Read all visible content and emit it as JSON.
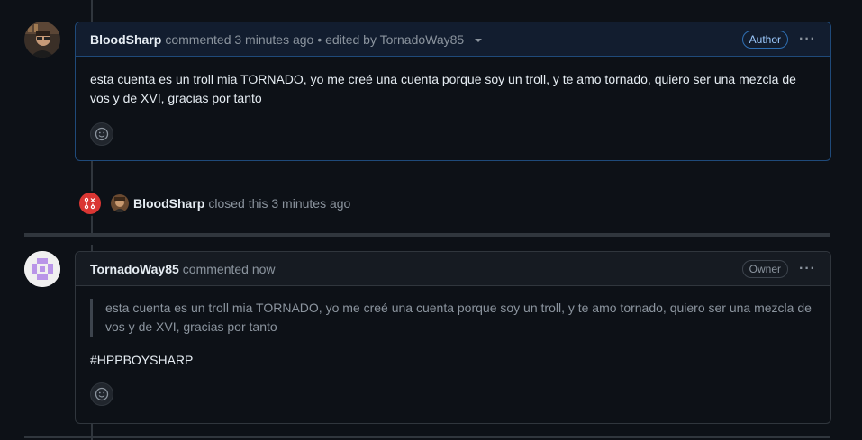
{
  "comment1": {
    "author": "BloodSharp",
    "action": "commented 3 minutes ago",
    "edited": "• edited by TornadoWay85",
    "badge": "Author",
    "body": "esta cuenta es un troll mia TORNADO, yo me creé una cuenta porque soy un troll, y te amo tornado, quiero ser una mezcla de vos y de XVI, gracias por tanto",
    "more_icon": "kebab-horizontal-icon",
    "reaction_icon": "smiley-icon"
  },
  "event": {
    "icon": "issue-closed-icon",
    "user": "BloodSharp",
    "text": "closed this 3 minutes ago",
    "color": "#da3633"
  },
  "comment2": {
    "author": "TornadoWay85",
    "action": "commented now",
    "badge": "Owner",
    "quote": "esta cuenta es un troll mia TORNADO, yo me creé una cuenta porque soy un troll, y te amo tornado, quiero ser una mezcla de vos y de XVI, gracias por tanto",
    "body": "#HPPBOYSHARP",
    "more_icon": "kebab-horizontal-icon",
    "reaction_icon": "smiley-icon"
  },
  "colors": {
    "background": "#0d1117",
    "border": "#30363d",
    "author_border": "#1f4a7a",
    "accent_closed": "#da3633",
    "identicon": "#b995e8"
  }
}
